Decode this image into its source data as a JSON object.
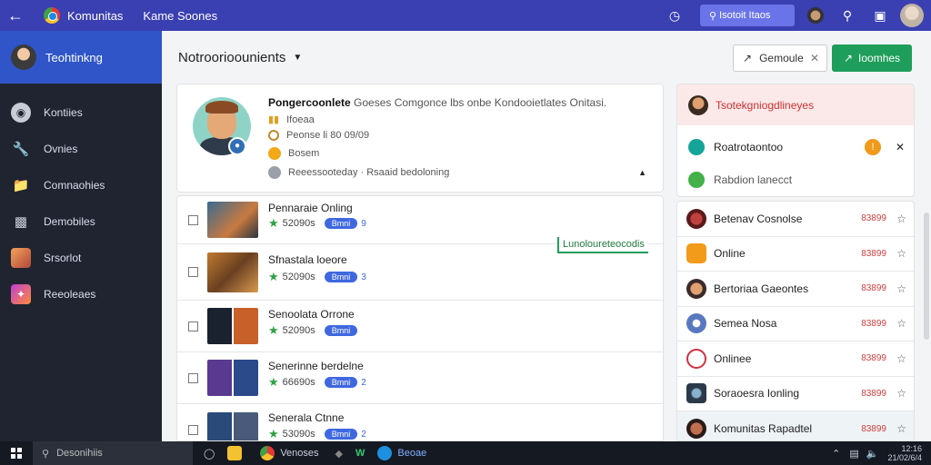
{
  "topbar": {
    "app_name": "Komunitas",
    "subtitle": "Kame Soones",
    "search_label": "Isotoit Itaos"
  },
  "sidebar": {
    "header": "Teohtinkng",
    "items": [
      {
        "label": "Kontiies",
        "icon": "record-icon"
      },
      {
        "label": "Ovnies",
        "icon": "wrench-icon"
      },
      {
        "label": "Comnaohies",
        "icon": "folder-icon"
      },
      {
        "label": "Demobiles",
        "icon": "archive-icon"
      },
      {
        "label": "Srsorlot",
        "icon": "image-icon"
      },
      {
        "label": "Reeoleaes",
        "icon": "sparkle-icon"
      }
    ]
  },
  "main": {
    "title": "Notroorioounients",
    "btn_outline": "Gemoule",
    "btn_green": "Ioomhes"
  },
  "profile": {
    "title_bold": "Pongercoonlete",
    "title_rest": "Goeses Comgonce lbs onbe Kondooietlates Onitasi.",
    "row1": "Ifoeaa",
    "row2": "Peonse li 80 09/09",
    "row3": "Bosem",
    "row4": "Reeessooteday · Rsaaid bedoloning"
  },
  "list": [
    {
      "name": "Pennaraie Onling",
      "num": "52090s",
      "pill": "Bmni",
      "count": "9"
    },
    {
      "name": "Sfnastala loeore",
      "num": "52090s",
      "pill": "Bmni",
      "count": "3"
    },
    {
      "name": "Senoolata Orrone",
      "num": "52090s",
      "pill": "Bmni",
      "count": ""
    },
    {
      "name": "Senerinne berdelne",
      "num": "66690s",
      "pill": "Bmni",
      "count": "2"
    },
    {
      "name": "Senerala Ctnne",
      "num": "53090s",
      "pill": "Bmni",
      "count": "2"
    }
  ],
  "callout": "Lunoloureteocodis",
  "panel1": {
    "header": "Tsotekgniogdlineyes",
    "row1": "Roatrotaontoo",
    "row2": "Rabdion lanecct"
  },
  "panel2": [
    {
      "name": "Betenav Cosnolse",
      "num": "83899"
    },
    {
      "name": "Online",
      "num": "83899"
    },
    {
      "name": "Bertoriaa Gaeontes",
      "num": "83899"
    },
    {
      "name": "Semea Nosa",
      "num": "83899"
    },
    {
      "name": "Onlinee",
      "num": "83899"
    },
    {
      "name": "Soraoesra Ionling",
      "num": "83899"
    },
    {
      "name": "Komunitas Rapadtel",
      "num": "83899"
    }
  ],
  "taskbar": {
    "search": "Desonihiis",
    "app1": "Venoses",
    "app2": "Beoae",
    "time": "12:16",
    "date": "21/02/6/4"
  },
  "colors": {
    "topbar": "#3a3fb1",
    "sidebar": "#1f2430",
    "accent_green": "#1e9e5a",
    "accent_blue": "#3f68e0"
  }
}
